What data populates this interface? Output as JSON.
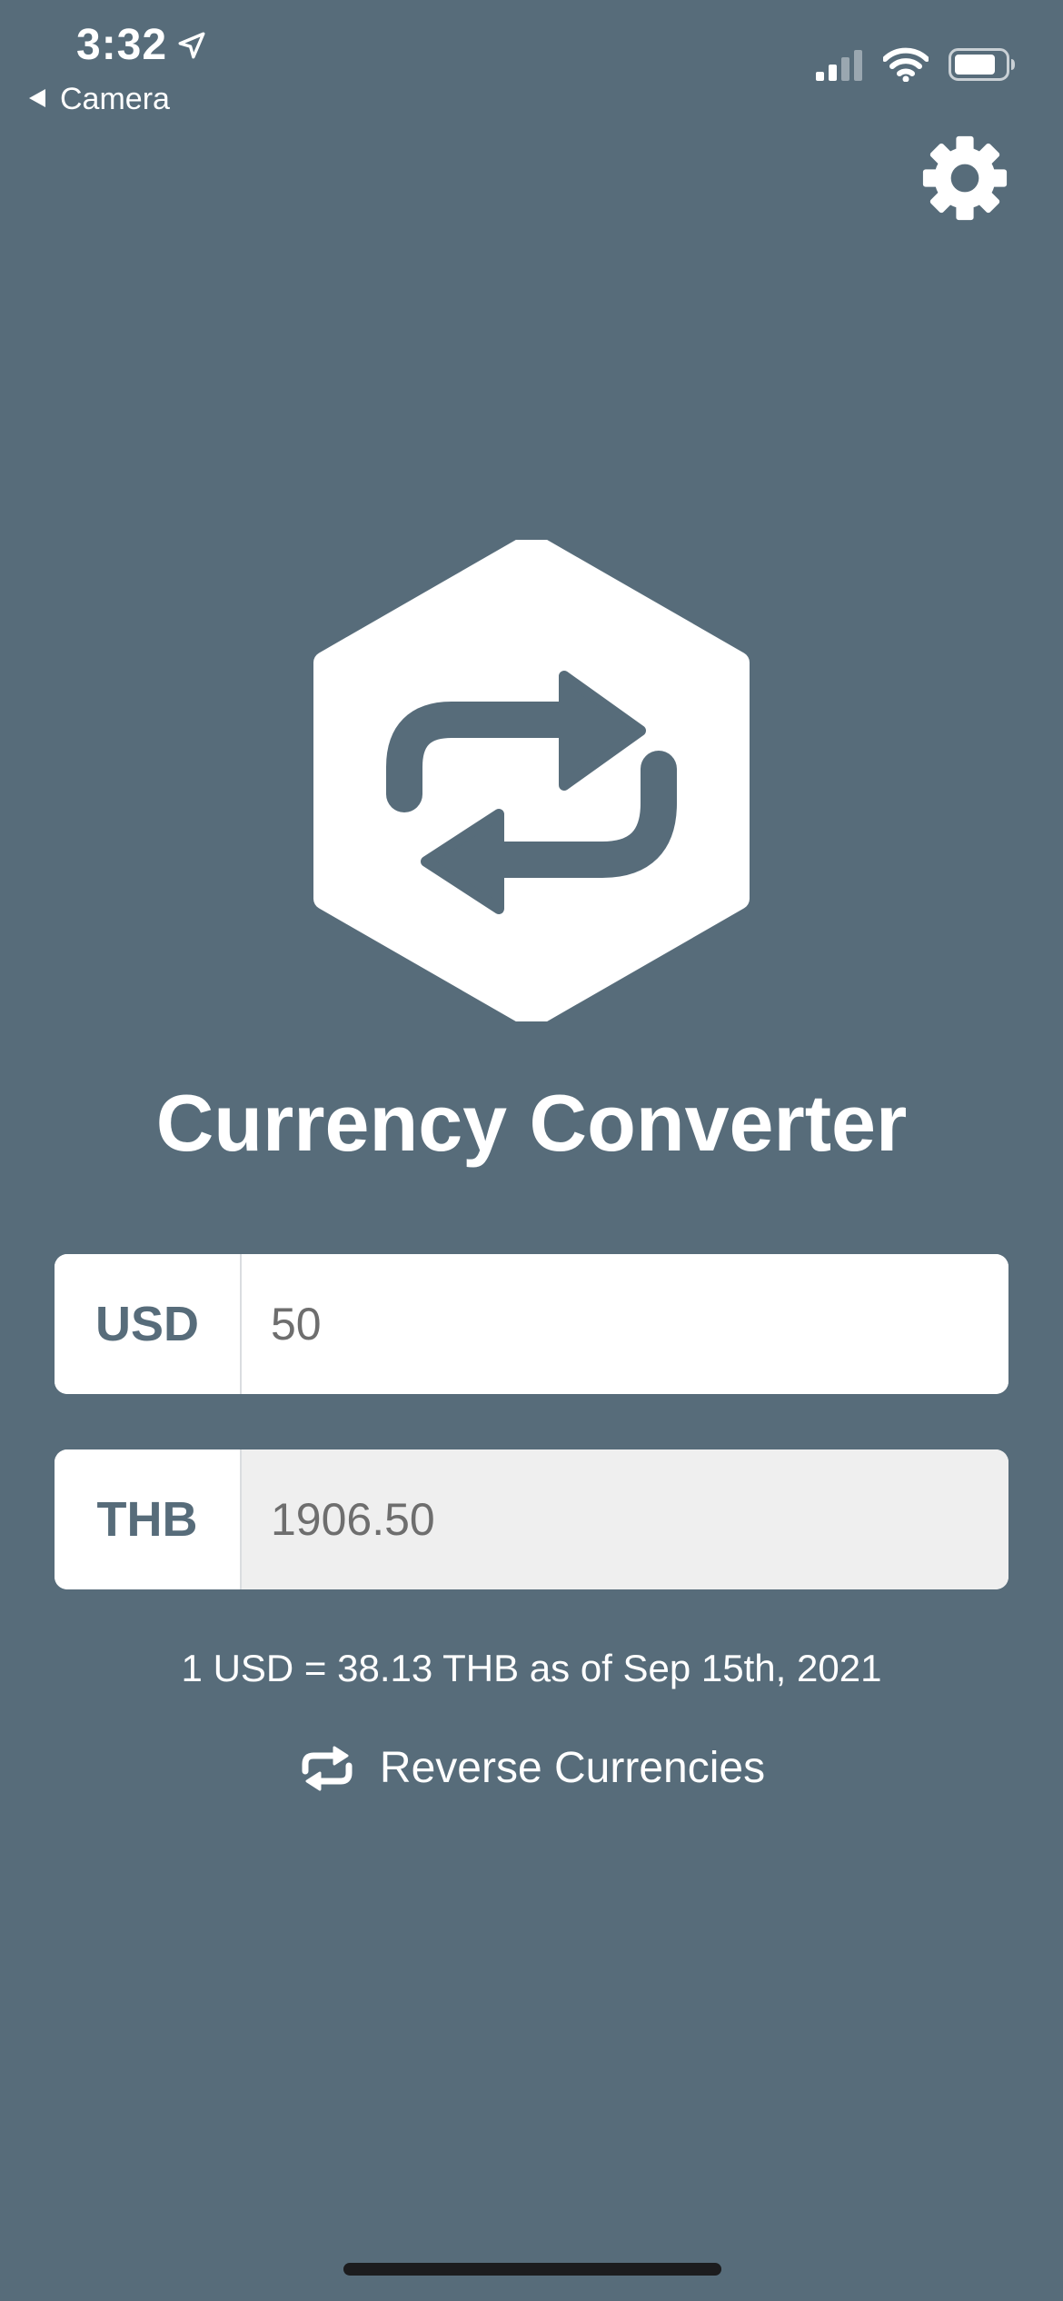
{
  "status_bar": {
    "time": "3:32",
    "back_app": "Camera",
    "icons": [
      "location-arrow-icon",
      "cellular-signal-icon",
      "wifi-icon",
      "battery-icon"
    ]
  },
  "header": {
    "settings_icon": "gear-icon"
  },
  "logo": {
    "icon": "exchange-arrows-hexagon-icon"
  },
  "title": "Currency Converter",
  "converter": {
    "from": {
      "code": "USD",
      "value": "50"
    },
    "to": {
      "code": "THB",
      "value": "1906.50"
    }
  },
  "rate_text": "1 USD = 38.13 THB as of Sep 15th, 2021",
  "reverse_button": {
    "label": "Reverse Currencies",
    "icon": "repeat-icon"
  },
  "colors": {
    "background": "#576C7A",
    "text": "#FFFFFF",
    "field_bg": "#FFFFFF",
    "readonly_field_bg": "#EFEFEF",
    "code_text": "#576C7A",
    "value_text": "#6E6E6E"
  }
}
